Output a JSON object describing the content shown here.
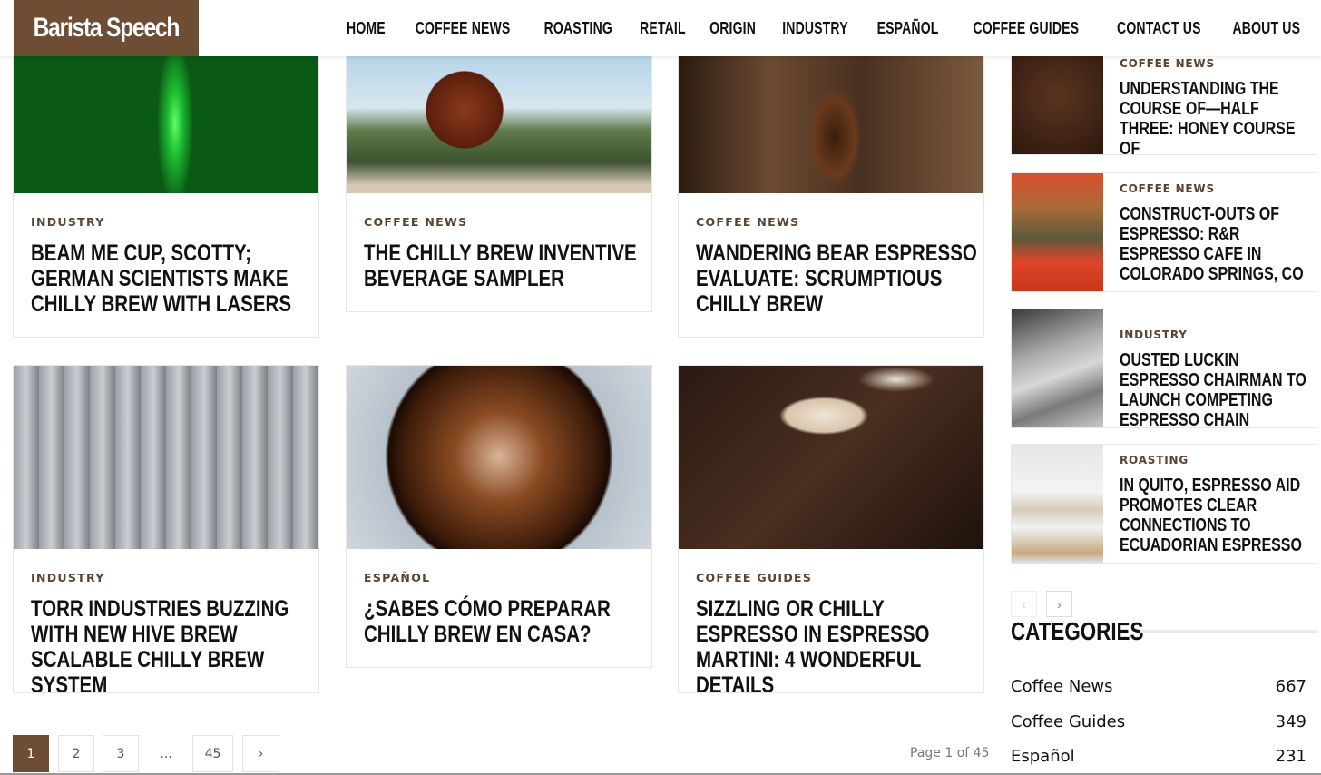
{
  "header": {
    "logo": "Barista Speech",
    "nav": [
      "HOME",
      "COFFEE NEWS",
      "ROASTING",
      "RETAIL",
      "ORIGIN",
      "INDUSTRY",
      "ESPAÑOL",
      "COFFEE GUIDES",
      "CONTACT US",
      "ABOUT US"
    ]
  },
  "colors": {
    "brand": "#6e4d35",
    "category_text": "#5b4330"
  },
  "cards": [
    {
      "category": "INDUSTRY",
      "title": "BEAM ME CUP, SCOTTY; GERMAN SCIENTISTS MAKE CHILLY BREW WITH LASERS",
      "image": "green-glowing-glass"
    },
    {
      "category": "COFFEE NEWS",
      "title": "THE CHILLY BREW INVENTIVE BEVERAGE SAMPLER",
      "image": "cold-brew-glass-outdoors"
    },
    {
      "category": "COFFEE NEWS",
      "title": "WANDERING BEAR ESPRESSO EVALUATE: SCRUMPTIOUS CHILLY BREW",
      "image": "iced-coffee-pour"
    },
    {
      "category": "INDUSTRY",
      "title": "TORR INDUSTRIES BUZZING WITH NEW HIVE BREW SCALABLE CHILLY BREW SYSTEM",
      "image": "hexagonal-brew-machine"
    },
    {
      "category": "ESPAÑOL",
      "title": "¿SABES CÓMO PREPARAR CHILLY BREW EN CASA?",
      "image": "iced-coffee-top-view"
    },
    {
      "category": "COFFEE GUIDES",
      "title": "SIZZLING OR CHILLY ESPRESSO IN ESPRESSO MARTINI: 4 WONDERFUL DETAILS",
      "image": "espresso-martinis"
    }
  ],
  "sidebar": {
    "items": [
      {
        "category": "COFFEE NEWS",
        "title": "UNDERSTANDING THE COURSE OF—HALF THREE: HONEY COURSE OF",
        "image": "coffee-beans"
      },
      {
        "category": "COFFEE NEWS",
        "title": "CONSTRUCT-OUTS OF ESPRESSO: R&R ESPRESSO CAFE IN COLORADO SPRINGS, CO",
        "image": "mural-painting"
      },
      {
        "category": "INDUSTRY",
        "title": "OUSTED LUCKIN ESPRESSO CHAIRMAN TO LAUNCH COMPETING ESPRESSO CHAIN",
        "image": "espresso-machine-pitcher"
      },
      {
        "category": "ROASTING",
        "title": "IN QUITO, ESPRESSO AID PROMOTES CLEAR CONNECTIONS TO ECUADORIAN ESPRESSO",
        "image": "white-cafe-interior"
      }
    ],
    "prev_label": "‹",
    "next_label": "›",
    "categories_heading": "CATEGORIES",
    "categories": [
      {
        "name": "Coffee News",
        "count": "667"
      },
      {
        "name": "Coffee Guides",
        "count": "349"
      },
      {
        "name": "Español",
        "count": "231"
      }
    ]
  },
  "pagination": {
    "pages": [
      "1",
      "2",
      "3",
      "...",
      "45"
    ],
    "current": "1",
    "next_label": "›",
    "info": "Page 1 of 45"
  }
}
